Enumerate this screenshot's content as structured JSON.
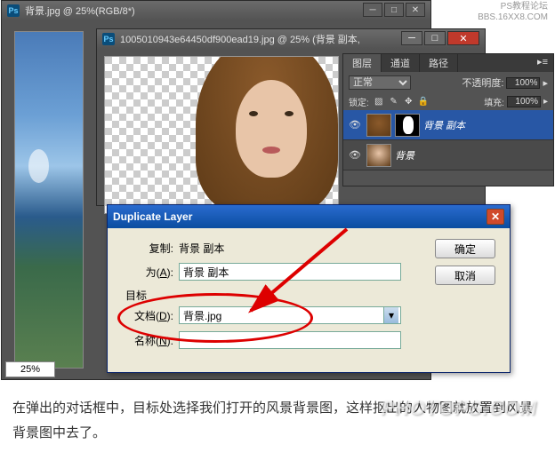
{
  "win1": {
    "title": "背景.jpg @ 25%(RGB/8*)",
    "zoom": "25%"
  },
  "win2": {
    "title": "1005010943e64450df900ead19.jpg @ 25% (背景 副本,"
  },
  "win_ctrls": {
    "min": "─",
    "max": "□",
    "close": "✕"
  },
  "layers": {
    "tabs": [
      "图层",
      "通道",
      "路径"
    ],
    "blend_mode": "正常",
    "opacity_label": "不透明度:",
    "opacity_value": "100%",
    "lock_label": "锁定:",
    "fill_label": "填充:",
    "fill_value": "100%",
    "items": [
      {
        "name": "背景 副本"
      },
      {
        "name": "背景"
      }
    ]
  },
  "dialog": {
    "title": "Duplicate Layer",
    "dup_label": "复制:",
    "dup_value": "背景 副本",
    "as_label_prefix": "为(",
    "as_label_ul": "A",
    "as_label_suffix": "):",
    "as_value": "背景 副本",
    "target_label": "目标",
    "doc_label_prefix": "文档(",
    "doc_label_ul": "D",
    "doc_label_suffix": "):",
    "doc_value": "背景.jpg",
    "name_label_prefix": "名称(",
    "name_label_ul": "N",
    "name_label_suffix": "):",
    "name_value": "",
    "ok": "确定",
    "cancel": "取消"
  },
  "caption": "在弹出的对话框中，目标处选择我们打开的风景背景图，这样抠出的人物图就放置到风景背景图中去了。",
  "watermark1_line1": "PS教程论坛",
  "watermark1_line2": "BBS.16XX8.COM",
  "watermark2": "PHOTOPS.COM"
}
